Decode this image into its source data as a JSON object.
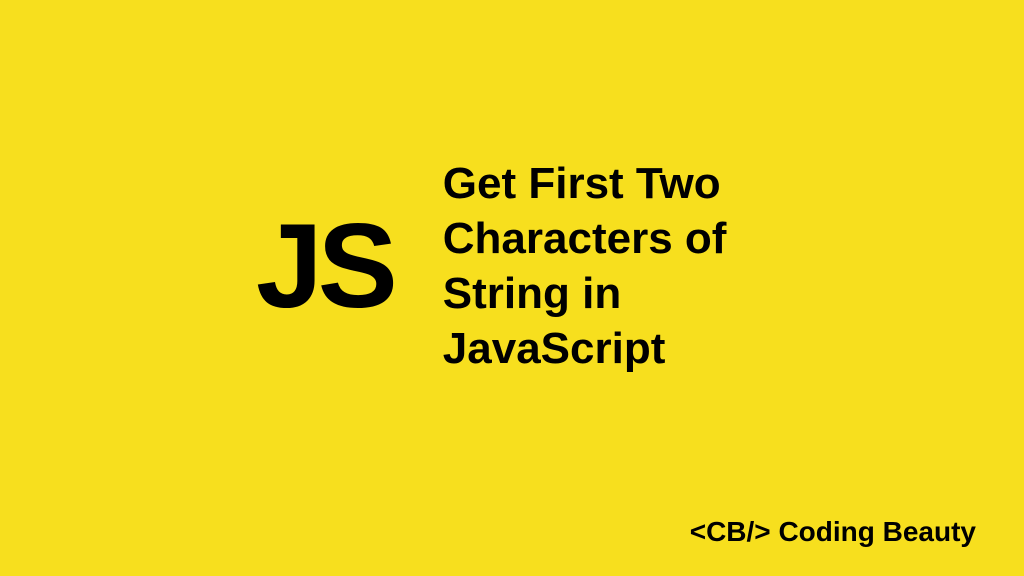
{
  "logo": "JS",
  "title": "Get First Two Characters of String in JavaScript",
  "brand": "<CB/> Coding Beauty"
}
